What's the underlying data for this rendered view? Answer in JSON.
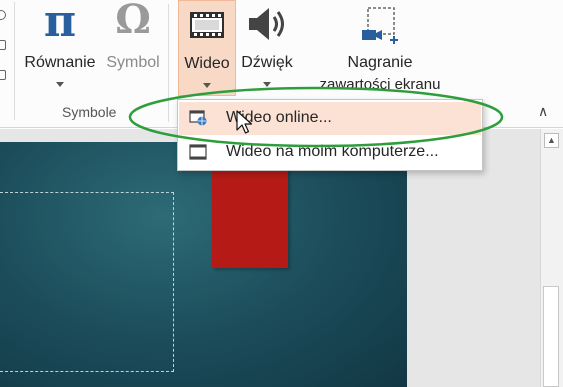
{
  "ribbon": {
    "buttons": {
      "equation": {
        "label": "Równanie"
      },
      "symbol": {
        "label": "Symbol"
      },
      "video": {
        "label": "Wideo"
      },
      "audio": {
        "label": "Dźwięk"
      },
      "screen_recording": {
        "label_line1": "Nagranie",
        "label_line2": "zawartości ekranu"
      }
    },
    "groups": {
      "symbols": "Symbole"
    },
    "collapse_glyph": "∧"
  },
  "video_menu": {
    "items": [
      {
        "label": "Wideo online...",
        "icon": "online-video-icon",
        "highlighted": true
      },
      {
        "label": "Wideo na moim komputerze...",
        "icon": "video-file-icon",
        "highlighted": false
      }
    ]
  },
  "scrollbar": {
    "up_glyph": "▲"
  },
  "colors": {
    "equation_icon": "#2a5f9e",
    "symbol_icon": "#9a9a9a",
    "video_pressed_bg": "#f7d9c6",
    "menu_highlight": "#fbe2d4",
    "annotation_oval": "#2e9e3c",
    "slide_bg": "#1c4d5b",
    "red_shape": "#b51a16"
  }
}
